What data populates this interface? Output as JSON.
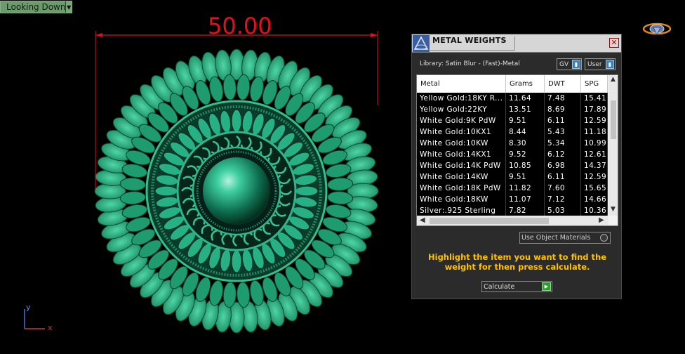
{
  "viewport": {
    "label": "Looking Down",
    "dimension": "50.00",
    "axis_y": "y",
    "axis_x": "x"
  },
  "panel": {
    "title": "METAL WEIGHTS",
    "close": "✕",
    "library": "Library: Satin Blur - (Fast)-Metal",
    "gv_select": "GV",
    "user_select": "User",
    "columns": [
      "Metal",
      "Grams",
      "DWT",
      "SPG"
    ],
    "rows": [
      [
        "Yellow Gold:18KY R...",
        "11.64",
        "7.48",
        "15.41"
      ],
      [
        "Yellow Gold:22KY",
        "13.51",
        "8.69",
        "17.89"
      ],
      [
        "White Gold:9K PdW",
        "9.51",
        "6.11",
        "12.59"
      ],
      [
        "White Gold:10KX1",
        "8.44",
        "5.43",
        "11.18"
      ],
      [
        "White Gold:10KW",
        "8.30",
        "5.34",
        "10.99"
      ],
      [
        "White Gold:14KX1",
        "9.52",
        "6.12",
        "12.61"
      ],
      [
        "White Gold:14K PdW",
        "10.85",
        "6.98",
        "14.37"
      ],
      [
        "White Gold:14KW",
        "9.51",
        "6.11",
        "12.59"
      ],
      [
        "White Gold:18K PdW",
        "11.82",
        "7.60",
        "15.65"
      ],
      [
        "White Gold:18KW",
        "11.07",
        "7.12",
        "14.66"
      ],
      [
        "Silver:.925 Sterling",
        "7.82",
        "5.03",
        "10.36"
      ]
    ],
    "use_object_materials": "Use Object Materials",
    "instruction": "Highlight the item you want to find the weight for then press calculate.",
    "calculate": "Calculate"
  },
  "colors": {
    "dimension": "#e0101e",
    "jewel": "#2fb58a",
    "instruction": "#ffc000"
  }
}
